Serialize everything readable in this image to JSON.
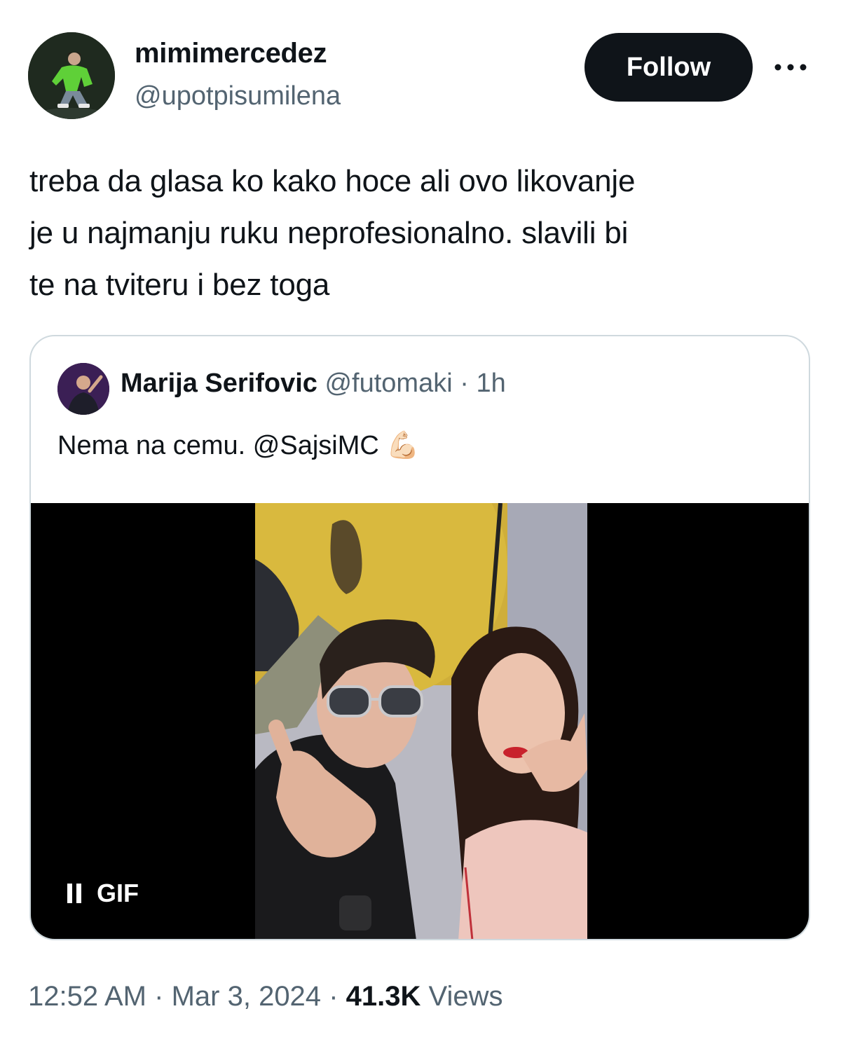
{
  "author": {
    "display_name": "mimimercedez",
    "handle": "@upotpisumilena",
    "avatar_icon": "profile-photo"
  },
  "actions": {
    "follow_label": "Follow",
    "more_icon": "more-horizontal-icon"
  },
  "tweet": {
    "text": "treba da glasa ko kako hoce ali ovo likovanje\nje u najmanju ruku neprofesionalno. slavili bi\nte na tviteru i bez toga"
  },
  "quoted": {
    "display_name": "Marija Serifovic",
    "handle": "@futomaki",
    "separator": "·",
    "time": "1h",
    "text": "Nema na cemu. @SajsiMC",
    "emoji": "💪🏻",
    "media": {
      "type_label": "GIF",
      "control_icon": "pause-icon"
    }
  },
  "footer": {
    "time": "12:52 AM",
    "separator": "·",
    "date": "Mar 3, 2024",
    "views_count": "41.3K",
    "views_label": "Views"
  },
  "colors": {
    "text_primary": "#0f1419",
    "text_secondary": "#536471",
    "border": "#cfd9de",
    "button_bg": "#0f1419",
    "media_bg": "#000000"
  }
}
